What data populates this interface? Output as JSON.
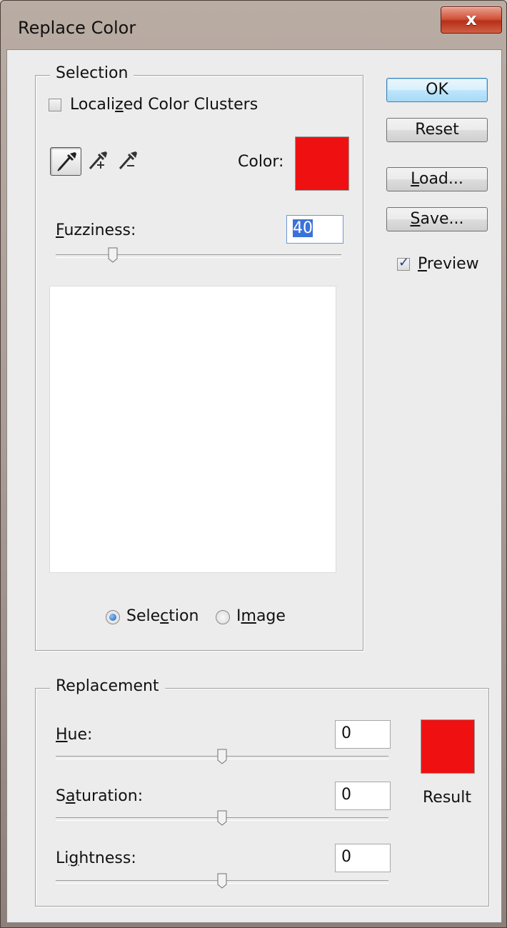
{
  "window": {
    "title": "Replace Color",
    "close_symbol": "x"
  },
  "selection": {
    "legend": "Selection",
    "localized": {
      "pre": "Locali",
      "key": "z",
      "post": "ed Color Clusters",
      "checked": false
    },
    "color_label": "Color:",
    "color": "#ef1111",
    "fuzziness": {
      "pre": "",
      "key": "F",
      "post": "uzziness:",
      "value": "40",
      "slider": 0.2
    },
    "view_options": [
      {
        "pre": "Sele",
        "key": "c",
        "post": "tion",
        "checked": true
      },
      {
        "pre": "I",
        "key": "m",
        "post": "age",
        "checked": false
      }
    ]
  },
  "buttons": {
    "ok": "OK",
    "reset": "Reset",
    "load": {
      "key": "L",
      "post": "oad..."
    },
    "save": {
      "key": "S",
      "post": "ave..."
    }
  },
  "preview": {
    "key": "P",
    "post": "review",
    "checked": true
  },
  "replacement": {
    "legend": "Replacement",
    "hue": {
      "pre": "",
      "key": "H",
      "post": "ue:",
      "value": "0",
      "slider": 0.5
    },
    "saturation": {
      "pre": "S",
      "key": "a",
      "post": "turation:",
      "value": "0",
      "slider": 0.5
    },
    "lightness": {
      "pre": "Li",
      "key": "g",
      "post": "htness:",
      "value": "0",
      "slider": 0.5
    },
    "result_label": "Result",
    "result_color": "#ef1111"
  }
}
